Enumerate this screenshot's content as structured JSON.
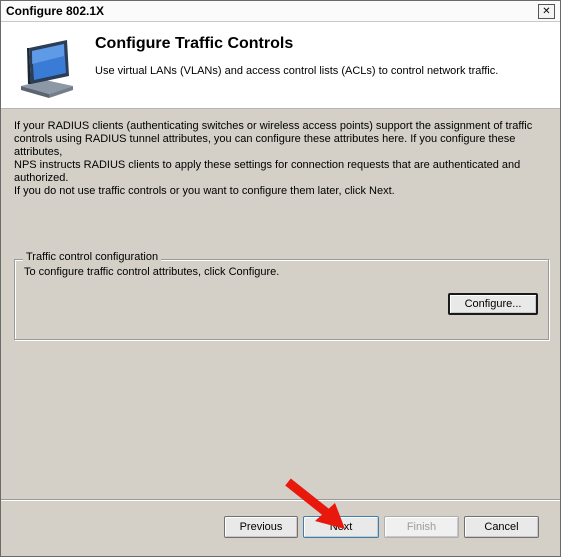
{
  "window": {
    "title": "Configure 802.1X"
  },
  "header": {
    "title": "Configure Traffic Controls",
    "subtitle": "Use virtual LANs (VLANs) and access control lists (ACLs) to control network traffic."
  },
  "body": {
    "paragraph1_line1": "If your RADIUS clients (authenticating switches or wireless access points) support the assignment of traffic",
    "paragraph1_line2": "controls using RADIUS tunnel attributes, you can configure these attributes here. If you configure these attributes,",
    "paragraph1_line3": "NPS instructs RADIUS clients to apply these settings for connection requests that are authenticated and",
    "paragraph1_line4": "authorized.",
    "paragraph2": "If you do not use traffic controls or you want to configure them later, click Next."
  },
  "group": {
    "legend": "Traffic control configuration",
    "description": "To configure traffic control attributes, click Configure.",
    "configure_label": "Configure..."
  },
  "buttons": {
    "previous": "Previous",
    "next": "Next",
    "finish": "Finish",
    "cancel": "Cancel"
  },
  "annotation": {
    "color": "#e8180d"
  }
}
